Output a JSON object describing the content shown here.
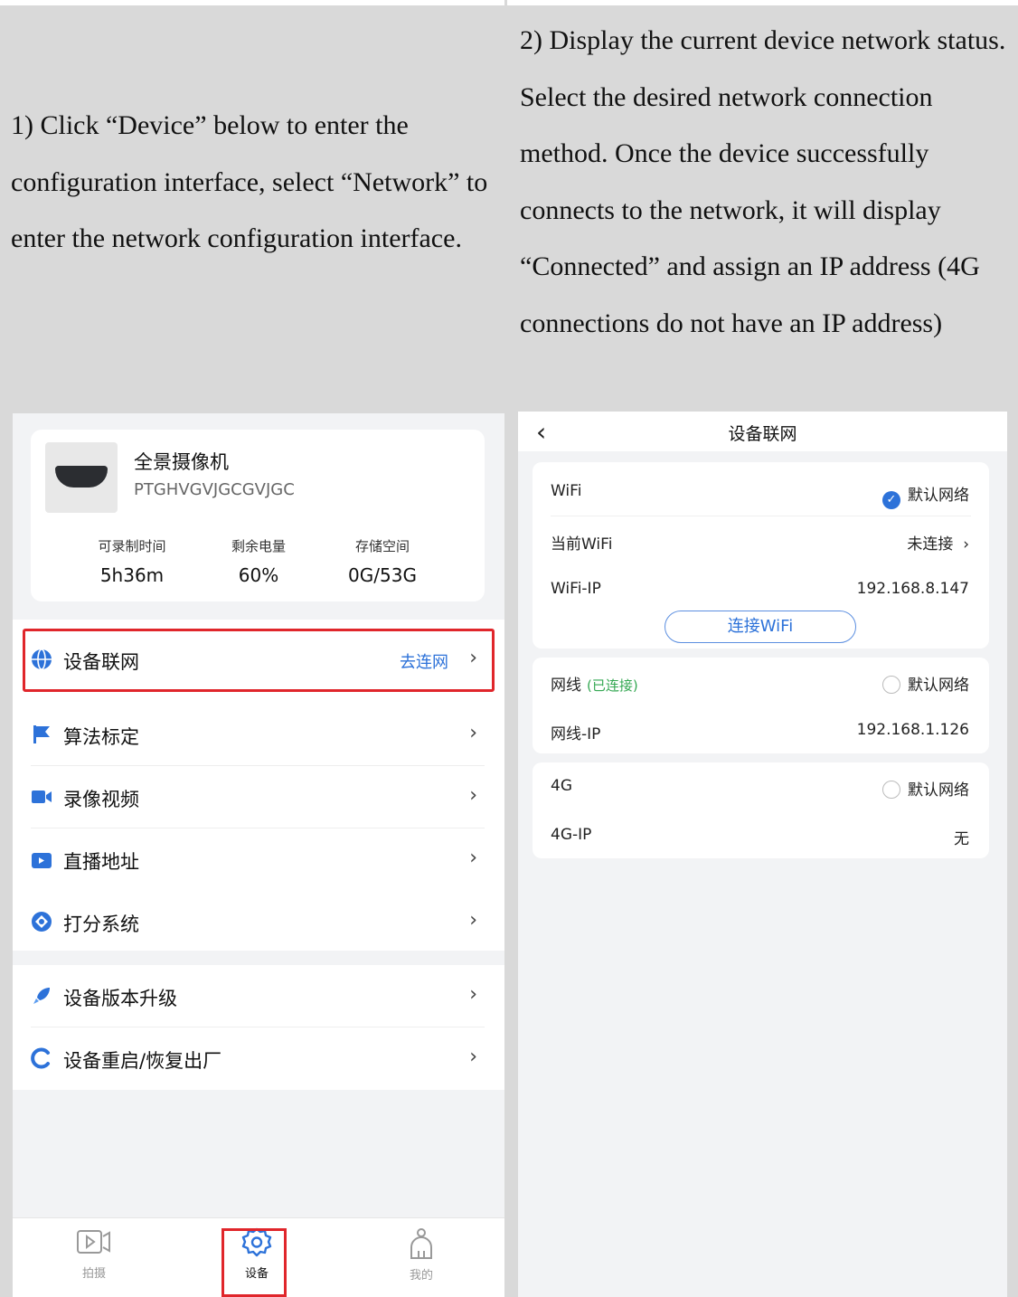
{
  "instructions": {
    "step1": "1) Click “Device” below to enter the configuration interface, select “Network” to enter the network configuration interface.",
    "step2": "2) Display the current device network status. Select the desired network connection method. Once the device successfully connects to the network, it will display “Connected” and assign an IP address (4G connections do not have an IP address)"
  },
  "device_page": {
    "camera": {
      "name": "全景摄像机",
      "serial": "PTGHVGVJGCGVJGC"
    },
    "stats": [
      {
        "label": "可录制时间",
        "value": "5h36m"
      },
      {
        "label": "剩余电量",
        "value": "60%"
      },
      {
        "label": "存储空间",
        "value": "0G/53G"
      }
    ],
    "menu": [
      {
        "label": "设备联网",
        "extra": "去连网",
        "icon": "globe-icon"
      },
      {
        "label": "算法标定",
        "icon": "flag-icon"
      },
      {
        "label": "录像视频",
        "icon": "video-camera-icon"
      },
      {
        "label": "直播地址",
        "icon": "tv-icon"
      },
      {
        "label": "打分系统",
        "icon": "score-icon"
      },
      {
        "label": "设备版本升级",
        "icon": "rocket-icon"
      },
      {
        "label": "设备重启/恢复出厂",
        "icon": "restart-icon"
      }
    ],
    "tabs": [
      {
        "label": "拍摄",
        "icon": "camera-play-icon"
      },
      {
        "label": "设备",
        "icon": "gear-icon",
        "active": true
      },
      {
        "label": "我的",
        "icon": "user-icon"
      }
    ],
    "colors": {
      "accent": "#2d72d9",
      "highlight": "#e0262b"
    }
  },
  "network_page": {
    "title": "设备联网",
    "wifi": {
      "label": "WiFi",
      "default_label": "默认网络",
      "current_label": "当前WiFi",
      "current_value": "未连接",
      "ip_label": "WiFi-IP",
      "ip_value": "192.168.8.147",
      "connect_button": "连接WiFi"
    },
    "ethernet": {
      "label": "网线",
      "status": "(已连接)",
      "default_label": "默认网络",
      "ip_label": "网线-IP",
      "ip_value": "192.168.1.126"
    },
    "cellular": {
      "label": "4G",
      "default_label": "默认网络",
      "ip_label": "4G-IP",
      "ip_value": "无"
    }
  }
}
